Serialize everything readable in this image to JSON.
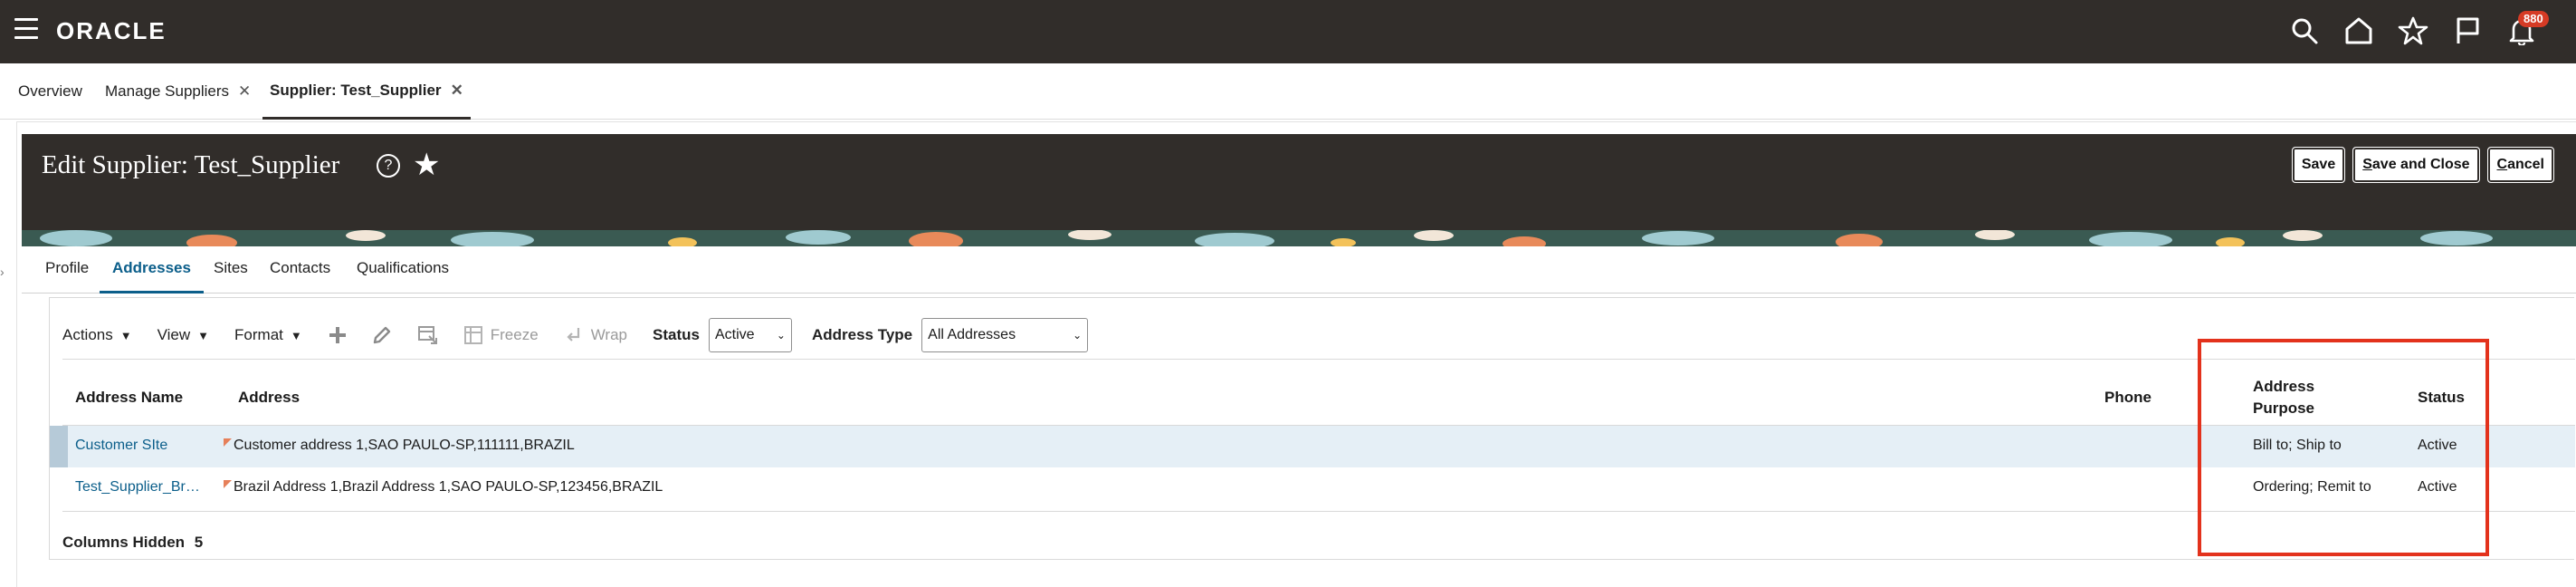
{
  "app": {
    "brand": "ORACLE",
    "notification_count": "880"
  },
  "tabs": [
    {
      "label": "Overview",
      "closable": false
    },
    {
      "label": "Manage Suppliers",
      "closable": true
    },
    {
      "label": "Supplier: Test_Supplier",
      "closable": true,
      "active": true
    }
  ],
  "header": {
    "title": "Edit Supplier: Test_Supplier",
    "help_icon": "?",
    "save": "Save",
    "save_close_u": "S",
    "save_close_rest": "ave and Close",
    "cancel_u": "C",
    "cancel_rest": "ancel"
  },
  "subtabs": [
    "Profile",
    "Addresses",
    "Sites",
    "Contacts",
    "Qualifications"
  ],
  "active_subtab": "Addresses",
  "toolbar": {
    "actions": "Actions",
    "view": "View",
    "format": "Format",
    "freeze": "Freeze",
    "wrap": "Wrap",
    "status_label": "Status",
    "status_value": "Active",
    "address_type_label": "Address Type",
    "address_type_value": "All Addresses"
  },
  "table": {
    "columns": {
      "address_name": "Address Name",
      "address": "Address",
      "phone": "Phone",
      "address_purpose_1": "Address",
      "address_purpose_2": "Purpose",
      "status": "Status"
    },
    "rows": [
      {
        "name": "Customer SIte",
        "address": "Customer address 1,SAO PAULO-SP,111111,BRAZIL",
        "phone": "",
        "purpose": "Bill to; Ship to",
        "status": "Active"
      },
      {
        "name": "Test_Supplier_Br…",
        "address": "Brazil Address 1,Brazil Address 1,SAO PAULO-SP,123456,BRAZIL",
        "phone": "",
        "purpose": "Ordering; Remit to",
        "status": "Active"
      }
    ]
  },
  "footer": {
    "columns_hidden_label": "Columns Hidden",
    "columns_hidden_count": "5"
  },
  "colors": {
    "topbar": "#312d2a",
    "link": "#0b5e8a",
    "highlight": "#e3321c",
    "badge": "#d63b25"
  }
}
